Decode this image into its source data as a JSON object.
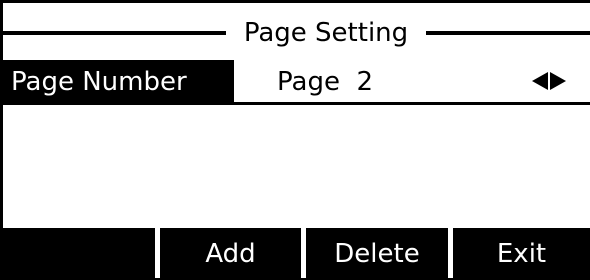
{
  "screen": {
    "title": "Page Setting"
  },
  "setting": {
    "label": "Page Number",
    "value": "Page  2",
    "left_arrow_icon": "triangle-left-icon",
    "right_arrow_icon": "triangle-right-icon"
  },
  "softkeys": [
    {
      "label": ""
    },
    {
      "label": "Add"
    },
    {
      "label": "Delete"
    },
    {
      "label": "Exit"
    }
  ],
  "colors": {
    "background": "#ffffff",
    "foreground": "#000000",
    "highlight_bg": "#000000",
    "highlight_fg": "#ffffff"
  }
}
